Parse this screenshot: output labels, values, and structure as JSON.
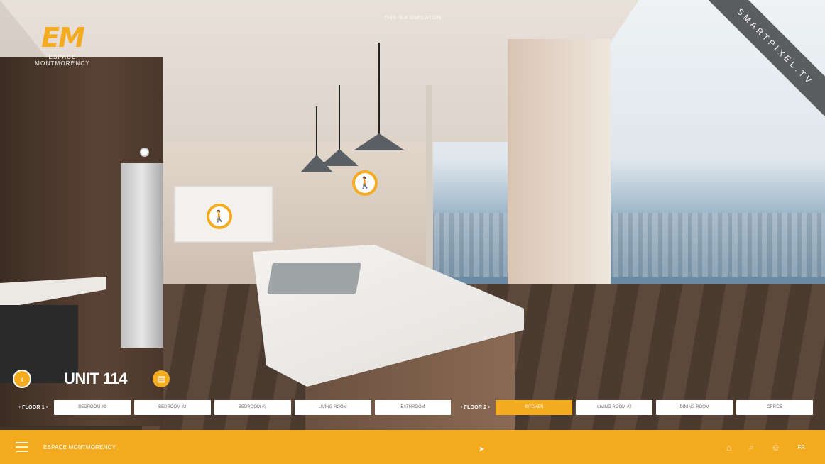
{
  "simulation_notice": "THIS IS A SIMULATION",
  "logo": {
    "mark": "EM",
    "name": "ESPACE MONTMORENCY"
  },
  "watermark": "SMARTPIXEL.TV",
  "unit": {
    "title": "UNIT 114"
  },
  "floors": [
    {
      "label": "• FLOOR 1 •",
      "rooms": [
        "BEDROOM #1",
        "BEDROOM #2",
        "BEDROOM #3",
        "LIVING ROOM",
        "BATHROOM"
      ]
    },
    {
      "label": "• FLOOR 2 •",
      "rooms": [
        "KITCHEN",
        "LIVING ROOM #2",
        "DINING ROOM",
        "OFFICE"
      ]
    }
  ],
  "active_room": "KITCHEN",
  "bottom_bar": {
    "title": "ESPACE MONTMORENCY",
    "language": "FR"
  },
  "icons": {
    "menu": "menu-icon",
    "back": "chevron-left-icon",
    "document": "document-icon",
    "walk": "walking-person-icon",
    "map": "map-icon",
    "search": "search-icon",
    "user": "user-icon"
  },
  "colors": {
    "accent": "#f4ab20",
    "button_bg": "#ffffff",
    "button_text": "#6c6c6c"
  }
}
